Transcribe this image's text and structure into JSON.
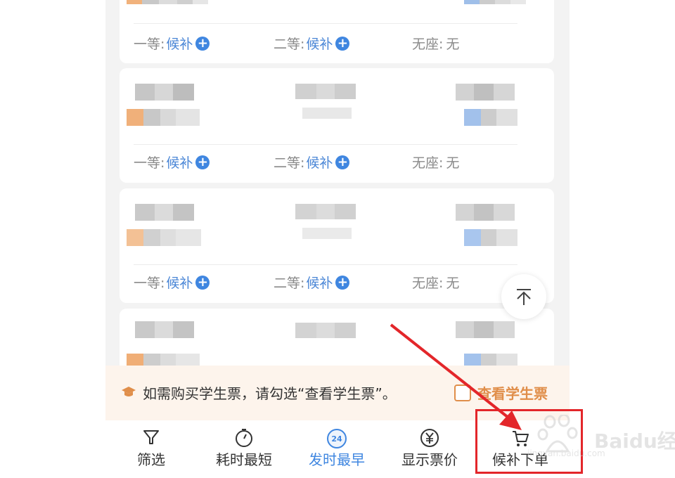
{
  "seats": {
    "first_label": "一等:",
    "first_value": "候补",
    "second_label": "二等:",
    "second_value": "候补",
    "none_label": "无座:",
    "none_value": "无"
  },
  "notice": {
    "message": "如需购买学生票，请勾选“查看学生票”。",
    "checkbox_label": "查看学生票",
    "checked": false
  },
  "tabs": [
    {
      "label": "筛选",
      "icon": "filter-icon",
      "active": false
    },
    {
      "label": "耗时最短",
      "icon": "timer-icon",
      "active": false
    },
    {
      "label": "发时最早",
      "icon": "clock-24-icon",
      "active": true,
      "badge": "24"
    },
    {
      "label": "显示票价",
      "icon": "yuan-icon",
      "active": false
    },
    {
      "label": "候补下单",
      "icon": "cart-icon",
      "active": false
    }
  ],
  "watermark": {
    "text": "Baidu经验",
    "sub": "jingyan.baidu.com"
  },
  "colors": {
    "accent": "#3f86e0",
    "orange": "#e08e4a",
    "annotation": "#e3262a"
  }
}
